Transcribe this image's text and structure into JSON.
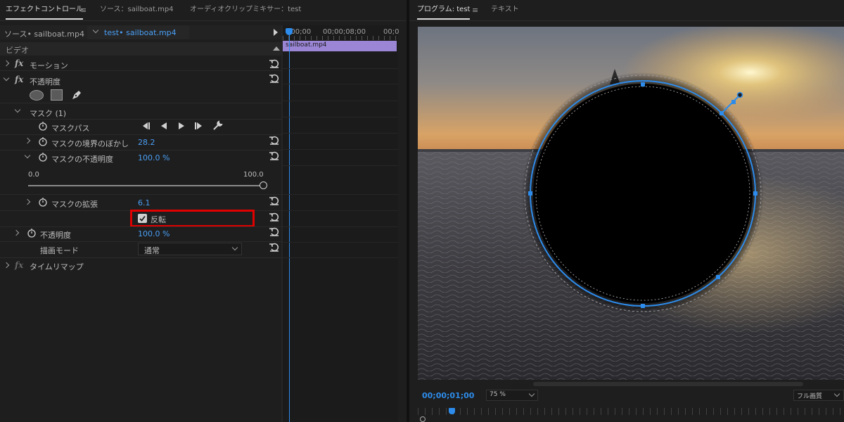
{
  "panel_tabs": {
    "effect_controls": "エフェクトコントロール",
    "source": "ソース：sailboat.mp4",
    "audio_mixer": "オーディオクリップミキサー：test",
    "program": "プログラム: test",
    "text": "テキスト"
  },
  "ec_header": {
    "source_clip": "ソース• sailboat.mp4",
    "sequence_clip": "test• sailboat.mp4"
  },
  "timeline": {
    "start_time": ";00;00",
    "mid_time": "00;00;08;00",
    "end_time": "00;0",
    "clip_label": "sailboat.mp4",
    "clip_color": "#9b86d6"
  },
  "effects": {
    "video_header": "ビデオ",
    "motion": "モーション",
    "opacity": "不透明度",
    "mask_group": "マスク (1)",
    "mask_path": "マスクパス",
    "mask_feather_label": "マスクの境界のぼかし",
    "mask_feather_value": "28.2",
    "mask_opacity_label": "マスクの不透明度",
    "mask_opacity_value": "100.0 %",
    "slider_min": "0.0",
    "slider_max": "100.0",
    "mask_opacity_fraction": 1.0,
    "mask_expansion_label": "マスクの拡張",
    "mask_expansion_value": "6.1",
    "inverted_label": "反転",
    "inverted_checked": true,
    "opacity_label": "不透明度",
    "opacity_value": "100.0 %",
    "blend_mode_label": "描画モード",
    "blend_mode_value": "通常",
    "time_remap": "タイムリマップ"
  },
  "program": {
    "timecode": "00;00;01;00",
    "zoom": "75 %",
    "quality": "フル画質"
  },
  "colors": {
    "accent_blue": "#2d8ceb",
    "highlight_red": "#e00000"
  }
}
